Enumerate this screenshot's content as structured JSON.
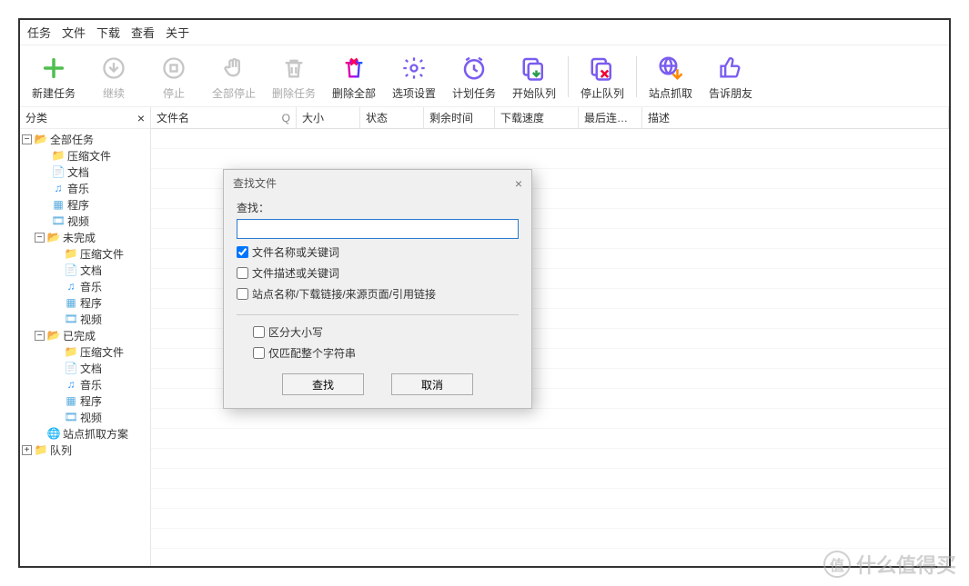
{
  "menu": {
    "task": "任务",
    "file": "文件",
    "download": "下载",
    "view": "查看",
    "about": "关于"
  },
  "toolbar": {
    "new_task": "新建任务",
    "resume": "继续",
    "stop": "停止",
    "stop_all": "全部停止",
    "delete_task": "删除任务",
    "delete_all": "删除全部",
    "options": "选项设置",
    "schedule": "计划任务",
    "start_queue": "开始队列",
    "stop_queue": "停止队列",
    "site_grab": "站点抓取",
    "tell_friend": "告诉朋友"
  },
  "sidebar": {
    "title": "分类",
    "nodes": {
      "all_tasks": "全部任务",
      "compressed": "压缩文件",
      "docs": "文档",
      "music": "音乐",
      "programs": "程序",
      "video": "视频",
      "unfinished": "未完成",
      "finished": "已完成",
      "site_plan": "站点抓取方案",
      "queue": "队列"
    }
  },
  "columns": {
    "filename": "文件名",
    "size": "大小",
    "status": "状态",
    "remaining": "剩余时间",
    "speed": "下载速度",
    "last": "最后连…",
    "desc": "描述"
  },
  "dialog": {
    "title": "查找文件",
    "find_label": "查找：",
    "opt_name": "文件名称或关键词",
    "opt_desc": "文件描述或关键词",
    "opt_site": "站点名称/下载链接/来源页面/引用链接",
    "case": "区分大小写",
    "whole": "仅匹配整个字符串",
    "find_btn": "查找",
    "cancel_btn": "取消"
  },
  "watermark": "什么值得买"
}
